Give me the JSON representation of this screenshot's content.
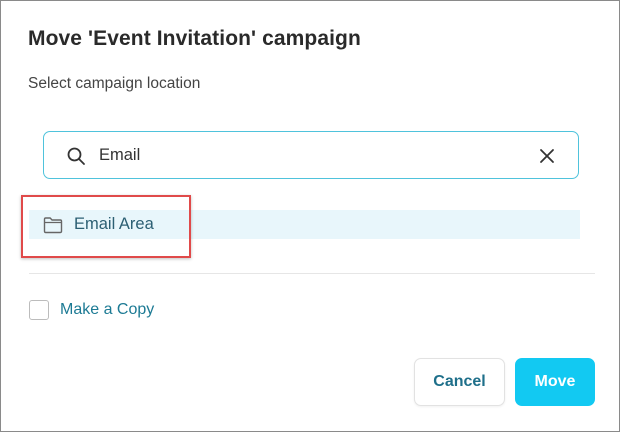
{
  "dialog": {
    "title": "Move 'Event Invitation' campaign",
    "subtitle": "Select campaign location"
  },
  "search": {
    "value": "Email",
    "search_icon": "search-icon",
    "clear_icon": "close-icon"
  },
  "results": [
    {
      "label": "Email Area",
      "icon": "folder-icon",
      "selected": true
    }
  ],
  "copy_option": {
    "label": "Make a Copy",
    "checked": false
  },
  "footer": {
    "cancel_label": "Cancel",
    "move_label": "Move"
  },
  "colors": {
    "accent": "#12c9f2",
    "search_border": "#4fc3dc",
    "row_highlight": "#e8f6fb",
    "annotation_border": "#e04a4a",
    "link_text": "#1c7a94"
  }
}
